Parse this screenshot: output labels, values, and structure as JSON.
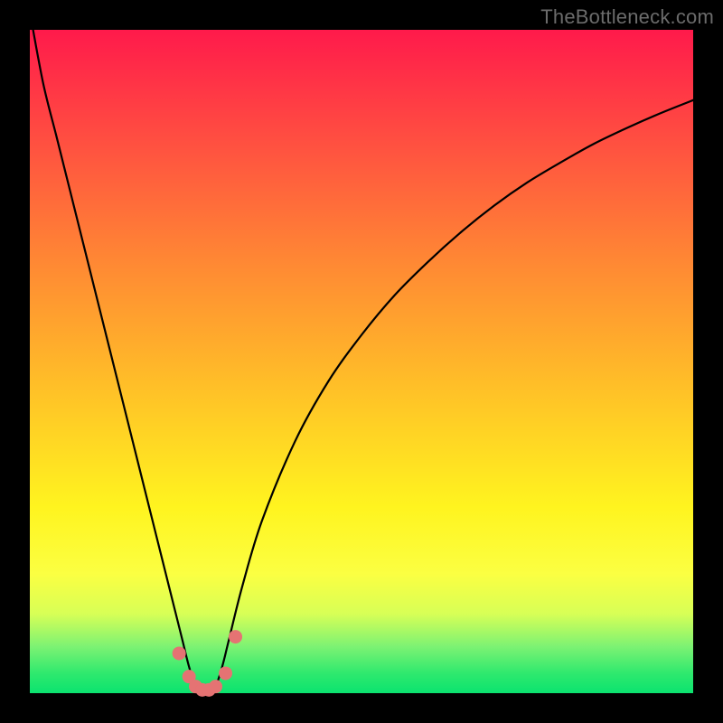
{
  "watermark": "TheBottleneck.com",
  "colors": {
    "frame": "#000000",
    "curve": "#000000",
    "marker": "#e57373",
    "gradient_top": "#ff1a4b",
    "gradient_bottom": "#0be36f"
  },
  "chart_data": {
    "type": "line",
    "title": "",
    "xlabel": "",
    "ylabel": "",
    "xlim": [
      0,
      100
    ],
    "ylim": [
      0,
      100
    ],
    "x": [
      0,
      2,
      4,
      6,
      8,
      10,
      12,
      14,
      16,
      18,
      19,
      20,
      21,
      22,
      23,
      24,
      25,
      26,
      27,
      28,
      29,
      30,
      32,
      35,
      40,
      45,
      50,
      55,
      60,
      65,
      70,
      75,
      80,
      85,
      90,
      95,
      100
    ],
    "series": [
      {
        "name": "bottleneck-curve",
        "values": [
          100,
          92,
          84,
          76,
          68,
          60,
          52,
          44,
          36,
          28,
          24,
          20,
          16,
          12,
          8,
          4,
          1,
          0,
          0,
          1,
          4,
          8,
          16,
          26,
          38,
          47,
          54,
          60,
          65,
          69.5,
          73.5,
          77,
          80,
          82.8,
          85.2,
          87.4,
          89.4
        ]
      }
    ],
    "markers": {
      "name": "near-optimum-points",
      "x": [
        22.5,
        24.0,
        25.0,
        26.0,
        27.0,
        28.0,
        29.5,
        31.0
      ],
      "y": [
        6.0,
        2.5,
        1.0,
        0.5,
        0.5,
        1.0,
        3.0,
        8.5
      ]
    }
  }
}
